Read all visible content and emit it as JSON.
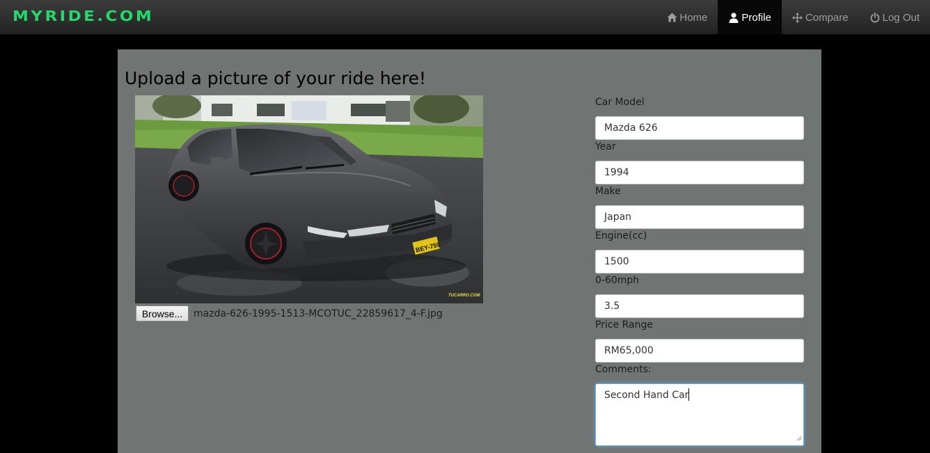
{
  "app": {
    "brand": "MYRIDE.COM",
    "accent_color": "#22d96a"
  },
  "nav": {
    "items": [
      {
        "label": "Home",
        "icon": "home-icon",
        "active": false
      },
      {
        "label": "Profile",
        "icon": "user-icon",
        "active": true
      },
      {
        "label": "Compare",
        "icon": "move-icon",
        "active": false
      },
      {
        "label": "Log Out",
        "icon": "power-icon",
        "active": false
      }
    ]
  },
  "upload": {
    "heading": "Upload a picture of your ride here!",
    "browse_label": "Browse...",
    "filename": "mazda-626-1995-1513-MCOTUC_22859617_4-F.jpg",
    "plate_text": "BEY-759",
    "watermark": "TUCARRO.COM"
  },
  "form": {
    "fields": [
      {
        "label": "Car Model",
        "value": "Mazda 626"
      },
      {
        "label": "Year",
        "value": "1994"
      },
      {
        "label": "Make",
        "value": "Japan"
      },
      {
        "label": "Engine(cc)",
        "value": "1500"
      },
      {
        "label": "0-60mph",
        "value": "3.5"
      },
      {
        "label": "Price Range",
        "value": "RM65,000"
      }
    ],
    "comments_label": "Comments:",
    "comments_value": "Second Hand Car"
  }
}
